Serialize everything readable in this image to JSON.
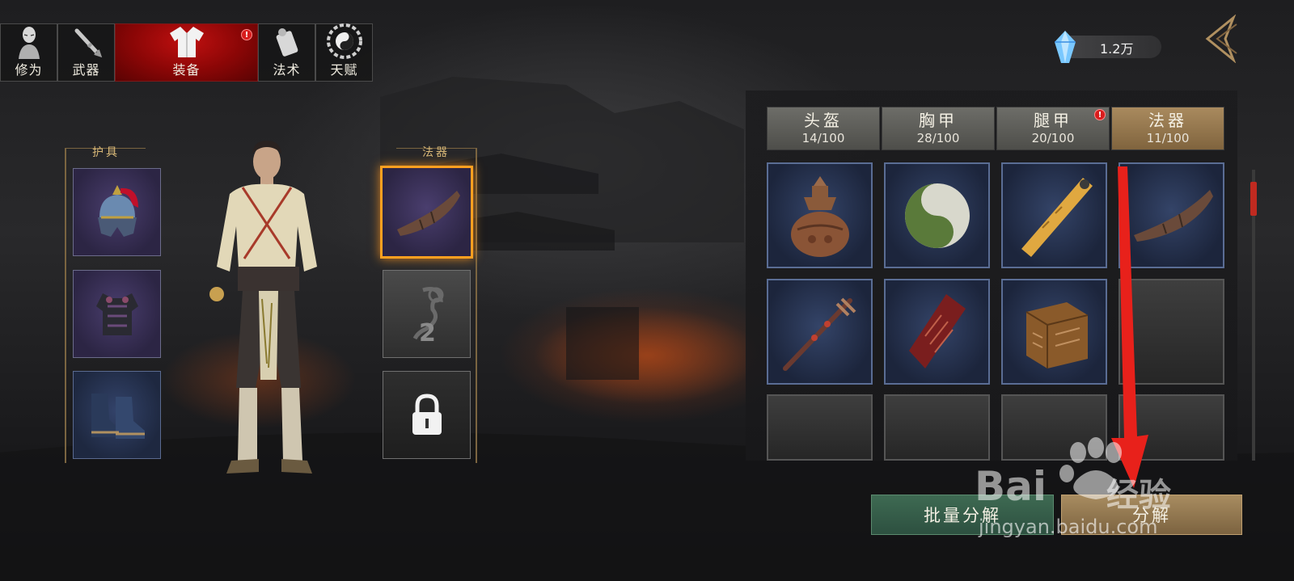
{
  "top_tabs": [
    {
      "label": "修为",
      "icon": "meditation-figure-icon",
      "active": false,
      "badge": false
    },
    {
      "label": "武器",
      "icon": "sword-icon",
      "active": false,
      "badge": false
    },
    {
      "label": "装备",
      "icon": "robe-icon",
      "active": true,
      "badge": true
    },
    {
      "label": "法术",
      "icon": "scroll-icon",
      "active": false,
      "badge": false
    },
    {
      "label": "天赋",
      "icon": "yin-yang-bagua-icon",
      "active": false,
      "badge": false
    }
  ],
  "badge_text": "!",
  "currency": {
    "value": "1.2万",
    "icon": "blue-crystal-icon"
  },
  "back_icon": "back-arrow-icon",
  "armor_section": {
    "label": "护具",
    "slots": [
      {
        "item": "helmet-icon"
      },
      {
        "item": "chest-armor-icon"
      },
      {
        "item": "boots-icon"
      }
    ]
  },
  "artifact_section": {
    "label": "法器",
    "slots": [
      {
        "item": "horn-icon",
        "selected": true
      },
      {
        "item": "empty-artifact-slot",
        "count": "2"
      },
      {
        "item": "lock-icon",
        "locked": true
      }
    ]
  },
  "category_tabs": [
    {
      "name": "头盔",
      "count": "14/100",
      "active": false,
      "badge": false
    },
    {
      "name": "胸甲",
      "count": "28/100",
      "active": false,
      "badge": false
    },
    {
      "name": "腿甲",
      "count": "20/100",
      "active": false,
      "badge": true
    },
    {
      "name": "法器",
      "count": "11/100",
      "active": true,
      "badge": false
    }
  ],
  "inventory": [
    {
      "item": "bronze-gourd-vessel-icon"
    },
    {
      "item": "jade-yin-yang-icon"
    },
    {
      "item": "wooden-ruler-icon"
    },
    {
      "item": "horn-icon"
    },
    {
      "item": "ornate-sword-icon"
    },
    {
      "item": "red-talisman-icon"
    },
    {
      "item": "bronze-seal-cube-icon"
    },
    {
      "item": "empty"
    },
    {
      "item": "empty"
    },
    {
      "item": "empty"
    },
    {
      "item": "empty"
    },
    {
      "item": "empty"
    }
  ],
  "buttons": {
    "batch": "批量分解",
    "decompose": "分解"
  },
  "watermark": {
    "brand": "Bai",
    "brand_cn": "经验",
    "sub": "jingyan.baidu.com"
  },
  "colors": {
    "active_tab": "#a01010",
    "selected_slot": "#ffa020",
    "annotation_arrow": "#e8211b",
    "batch_button": "#3e6a52",
    "decompose_button": "#a88c60"
  }
}
